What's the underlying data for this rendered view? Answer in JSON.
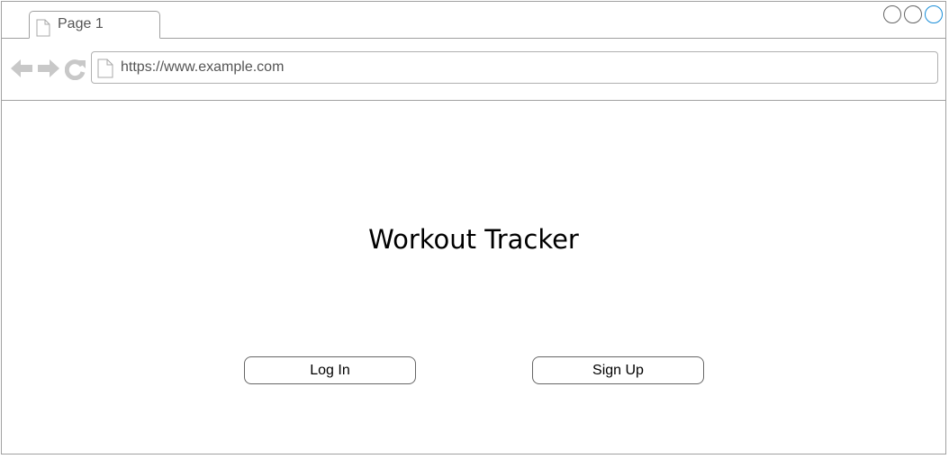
{
  "browser": {
    "tab": {
      "label": "Page 1"
    },
    "address": {
      "url": "https://www.example.com"
    },
    "colors": {
      "border": "#a0a0a0",
      "nav_icon": "#c8c8c8",
      "active_control": "#1a8ed8"
    }
  },
  "main": {
    "title": "Workout Tracker",
    "login_label": "Log In",
    "signup_label": "Sign Up"
  }
}
